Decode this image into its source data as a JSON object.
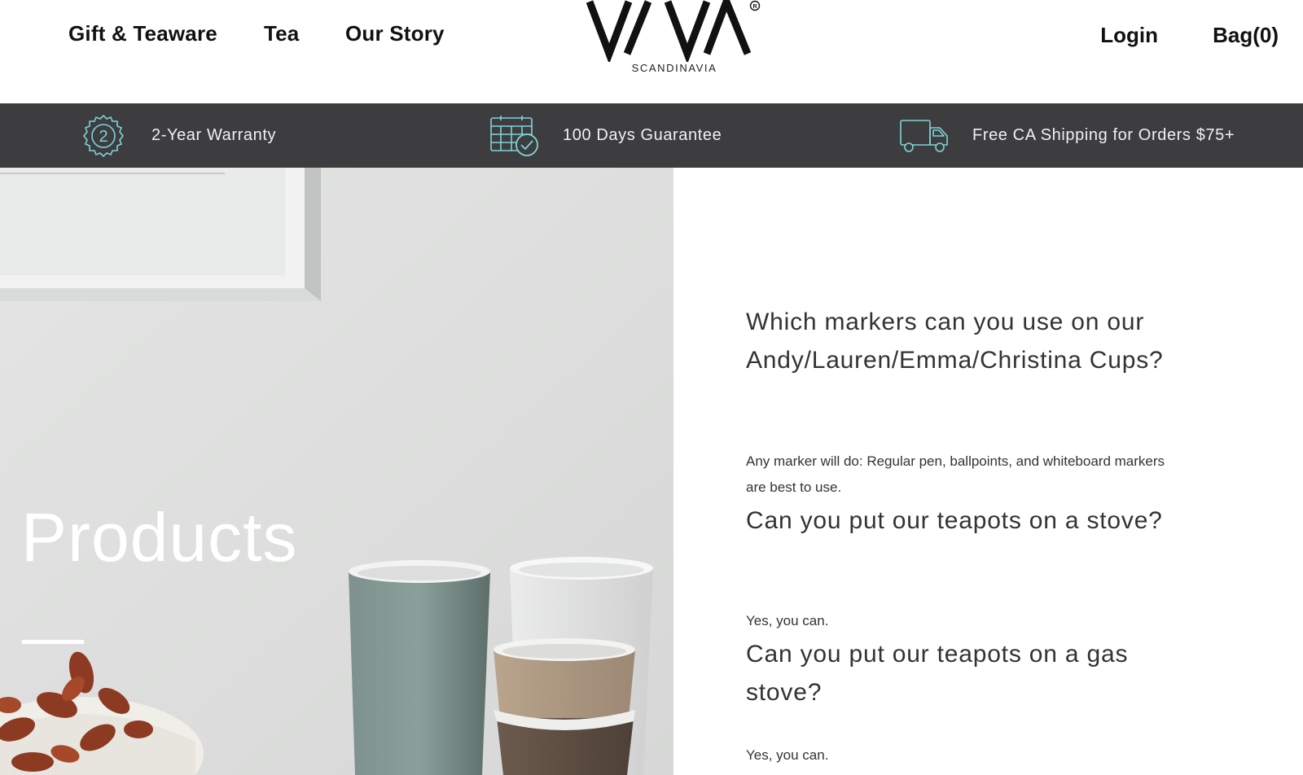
{
  "header": {
    "nav_left": [
      {
        "label": "Gift & Teaware"
      },
      {
        "label": "Tea"
      },
      {
        "label": "Our Story"
      }
    ],
    "logo": {
      "wordmark": "VIVA",
      "subtitle": "SCANDINAVIA",
      "registered": "R"
    },
    "nav_right": {
      "login": "Login",
      "bag": "Bag(0)"
    }
  },
  "perks": [
    {
      "icon": "warranty-badge-icon",
      "badge_number": "2",
      "text": "2-Year Warranty"
    },
    {
      "icon": "calendar-check-icon",
      "text": "100 Days Guarantee"
    },
    {
      "icon": "delivery-truck-icon",
      "text": "Free CA Shipping for Orders $75+"
    }
  ],
  "hero": {
    "title": "Products"
  },
  "faq": [
    {
      "question": "Which markers can you use on our Andy/Lauren/Emma/Christina Cups?",
      "answer": "Any marker will do: Regular pen, ballpoints, and whiteboard markers are best to use."
    },
    {
      "question": "Can you put our teapots on a stove?",
      "answer": "Yes, you can."
    },
    {
      "question": "Can you put our teapots on a gas stove?",
      "answer": "Yes, you can."
    }
  ],
  "colors": {
    "perks_bar": "#3d3d40",
    "perk_icon": "#7fd3d6",
    "text_dark": "#111111",
    "faq_text": "#333333"
  }
}
